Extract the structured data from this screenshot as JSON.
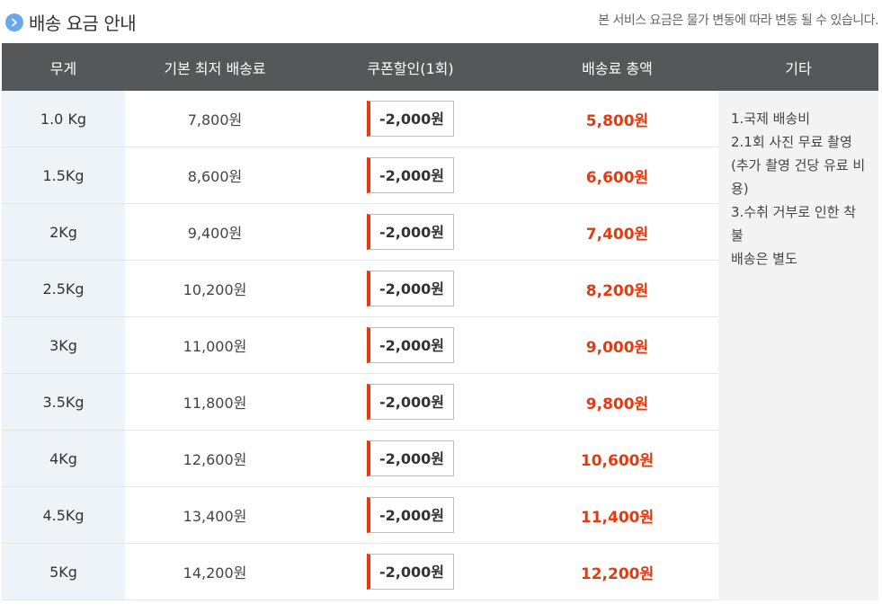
{
  "header": {
    "title": "배송 요금 안내",
    "notice": "본 서비스 요금은 물가 변동에 따라 변동 될 수 있습니다."
  },
  "table": {
    "columns": [
      "무게",
      "기본 최저 배송료",
      "쿠폰할인(1회)",
      "배송료 총액",
      "기타"
    ],
    "rows": [
      {
        "weight": "1.0 Kg",
        "base": "7,800원",
        "coupon": "-2,000원",
        "total": "5,800원"
      },
      {
        "weight": "1.5Kg",
        "base": "8,600원",
        "coupon": "-2,000원",
        "total": "6,600원"
      },
      {
        "weight": "2Kg",
        "base": "9,400원",
        "coupon": "-2,000원",
        "total": "7,400원"
      },
      {
        "weight": "2.5Kg",
        "base": "10,200원",
        "coupon": "-2,000원",
        "total": "8,200원"
      },
      {
        "weight": "3Kg",
        "base": "11,000원",
        "coupon": "-2,000원",
        "total": "9,000원"
      },
      {
        "weight": "3.5Kg",
        "base": "11,800원",
        "coupon": "-2,000원",
        "total": "9,800원"
      },
      {
        "weight": "4Kg",
        "base": "12,600원",
        "coupon": "-2,000원",
        "total": "10,600원"
      },
      {
        "weight": "4.5Kg",
        "base": "13,400원",
        "coupon": "-2,000원",
        "total": "11,400원"
      },
      {
        "weight": "5Kg",
        "base": "14,200원",
        "coupon": "-2,000원",
        "total": "12,200원"
      }
    ],
    "etc_lines": [
      "1.국제 배송비",
      "2.1회 사진 무료 촬영",
      "(추가 촬영 건당 유료 비",
      "용)",
      "3.수취 거부로 인한 착불",
      "배송은 별도"
    ]
  },
  "colors": {
    "header_bg": "#555758",
    "accent_red": "#e8380d",
    "weight_col_bg": "#eef3f7",
    "etc_col_bg": "#f3f3f3",
    "title_icon": "#6aa9e9"
  },
  "icons": {
    "title_icon": "chevron-right-circle-icon"
  }
}
